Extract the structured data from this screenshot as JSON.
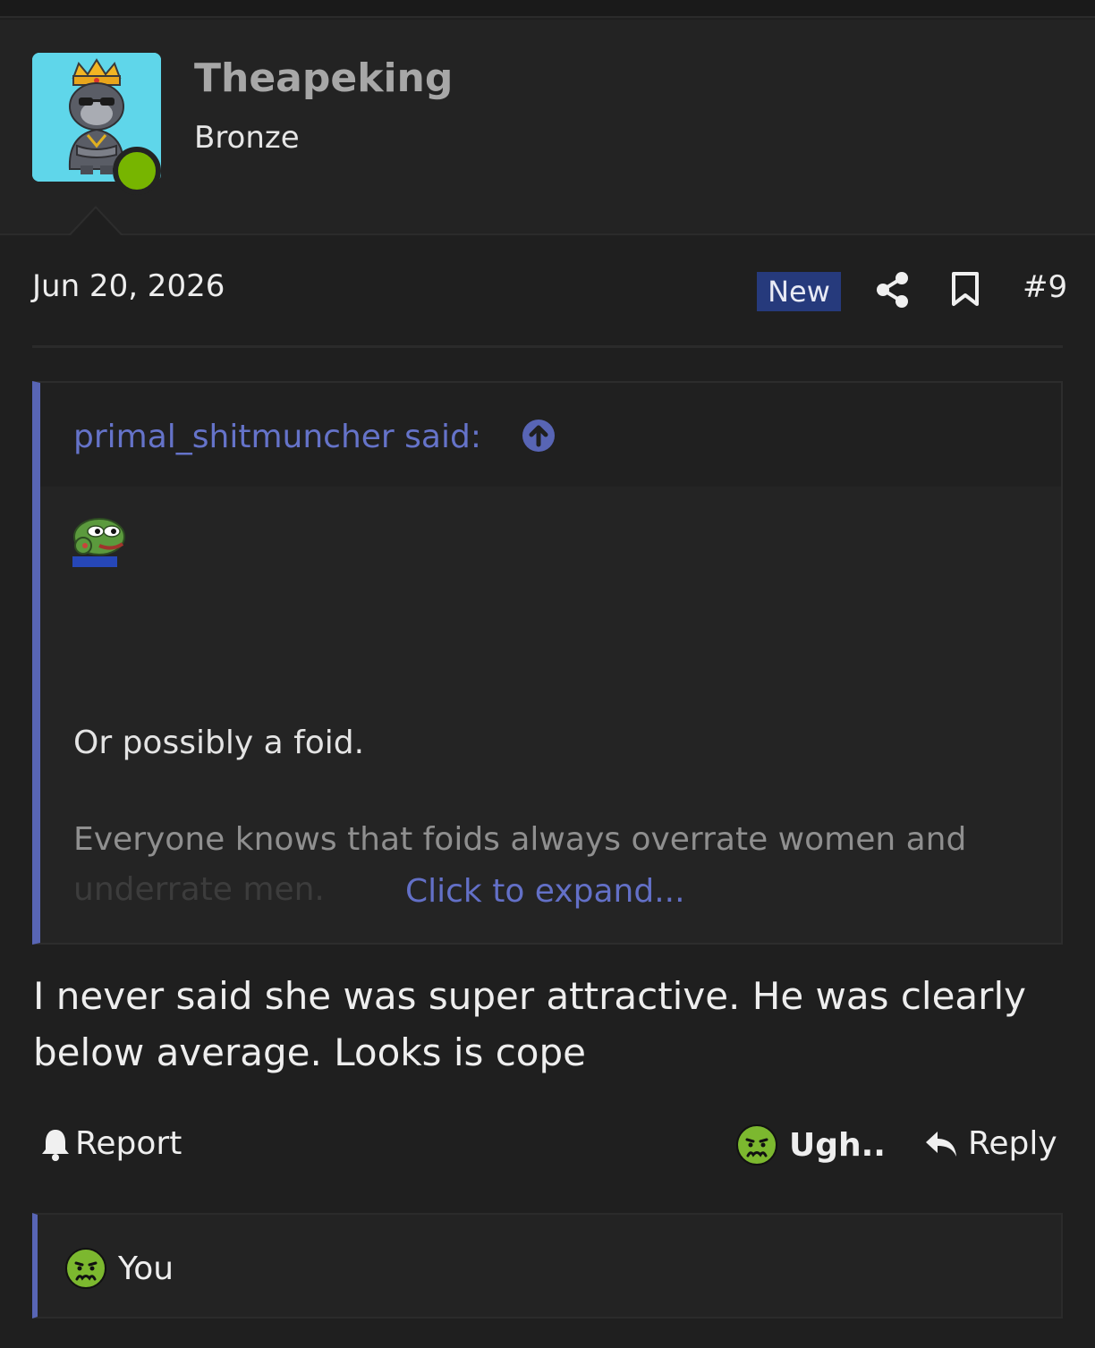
{
  "user": {
    "name": "Theapeking",
    "title": "Bronze",
    "online": true
  },
  "post": {
    "date": "Jun 20, 2026",
    "badge": "New",
    "number": "#9",
    "body": "I never said she was super attractive. He was clearly below average. Looks is cope"
  },
  "quote": {
    "author_label": "primal_shitmuncher said:",
    "line1": "Or possibly a foid.",
    "line2": "Everyone knows that foids always overrate women and",
    "line3": "underrate men.",
    "expand_label": "Click to expand..."
  },
  "actions": {
    "report_label": "Report",
    "reaction_label": "Ugh..",
    "reply_label": "Reply"
  },
  "reactions": {
    "user": "You"
  },
  "icons": {
    "share": "share-icon",
    "bookmark": "bookmark-icon",
    "quote_jump": "arrow-up-circle-icon",
    "report": "bell-icon",
    "reaction": "sick-face-icon",
    "reply": "reply-arrow-icon"
  },
  "colors": {
    "accent": "#5865b5",
    "link": "#6370c7",
    "new_badge": "#263a7c",
    "online": "#77b500",
    "reaction_face": "#7cb82f"
  }
}
